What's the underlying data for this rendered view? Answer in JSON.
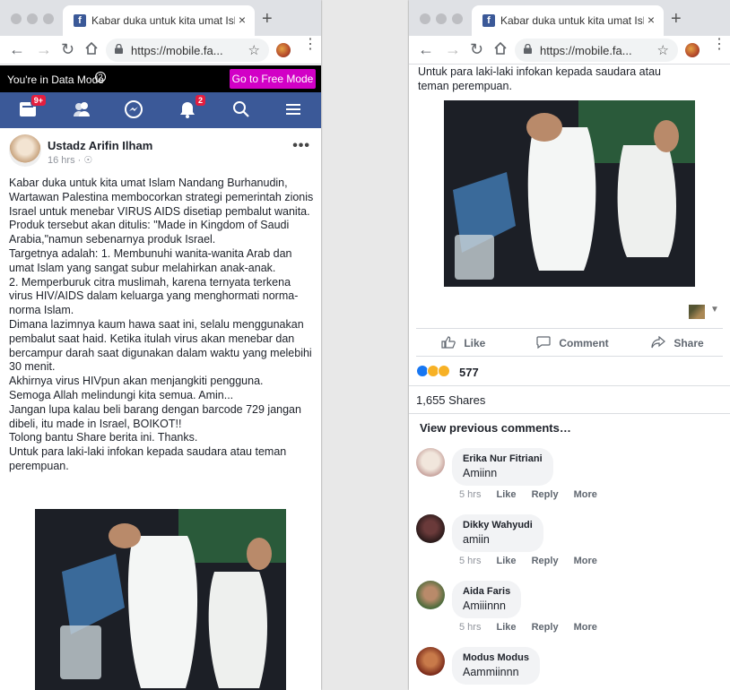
{
  "browser": {
    "tab_title": "Kabar duka untuk kita umat Islam...",
    "tab_favicon": "f",
    "url": "https://mobile.fa...",
    "new_tab": "+",
    "close": "×"
  },
  "data_mode": {
    "text": "You're in Data Mode",
    "button": "Go to Free Mode"
  },
  "nav": {
    "feed_badge": "9+",
    "notif_badge": "2"
  },
  "post": {
    "author": "Ustadz Arifin Ilham",
    "time": "16 hrs · ",
    "paragraphs": [
      "Kabar duka untuk kita umat Islam Nandang Burhanudin, Wartawan Palestina membocorkan strategi pemerintah zionis Israel untuk menebar VIRUS AIDS disetiap pembalut wanita.",
      "Produk tersebut akan ditulis: \"Made in Kingdom of Saudi Arabia,\"namun sebenarnya produk Israel.",
      "Targetnya adalah: 1. Membunuhi wanita-wanita Arab dan umat Islam yang sangat subur melahirkan anak-anak.",
      "2. Memperburuk citra muslimah, karena ternyata terkena virus HIV/AIDS dalam keluarga yang menghormati norma-norma Islam.",
      "Dimana lazimnya kaum hawa saat ini, selalu menggunakan pembalut saat haid. Ketika itulah virus akan menebar dan bercampur darah saat digunakan dalam waktu yang melebihi 30 menit.",
      "Akhirnya virus HIVpun akan menjangkiti pengguna.",
      "Semoga Allah melindungi kita semua. Amin...",
      "Jangan lupa kalau beli barang dengan barcode 729 jangan dibeli, itu made in Israel, BOIKOT!!",
      "Tolong bantu Share berita ini. Thanks.",
      "Untuk para laki-laki infokan kepada saudara atau teman perempuan."
    ],
    "right_text": "Untuk para laki-laki infokan kepada saudara atau\nteman perempuan."
  },
  "actions": {
    "like": "Like",
    "comment": "Comment",
    "share": "Share"
  },
  "stats": {
    "reactions": "577",
    "shares": "1,655 Shares"
  },
  "view_previous": "View previous comments…",
  "comments": [
    {
      "name": "Erika Nur Fitriani",
      "text": "Amiinn",
      "time": "5 hrs",
      "like": "Like",
      "reply": "Reply",
      "more": "More"
    },
    {
      "name": "Dikky Wahyudi",
      "text": "amiin",
      "time": "5 hrs",
      "like": "Like",
      "reply": "Reply",
      "more": "More"
    },
    {
      "name": "Aida Faris",
      "text": "Amiiinnn",
      "time": "5 hrs",
      "like": "Like",
      "reply": "Reply",
      "more": "More"
    },
    {
      "name": "Modus Modus",
      "text": "Aammiinnn"
    }
  ],
  "colors": {
    "fb_blue": "#3b5998",
    "free_mode": "#d200c6",
    "badge_red": "#e41e3f"
  },
  "icons": [
    "back-arrow-icon",
    "forward-arrow-icon",
    "reload-icon",
    "home-icon",
    "lock-icon",
    "star-icon",
    "news-feed-icon",
    "friends-icon",
    "messenger-icon",
    "bell-icon",
    "search-icon",
    "menu-icon",
    "like-thumb-icon",
    "comment-bubble-icon",
    "share-arrow-icon"
  ]
}
